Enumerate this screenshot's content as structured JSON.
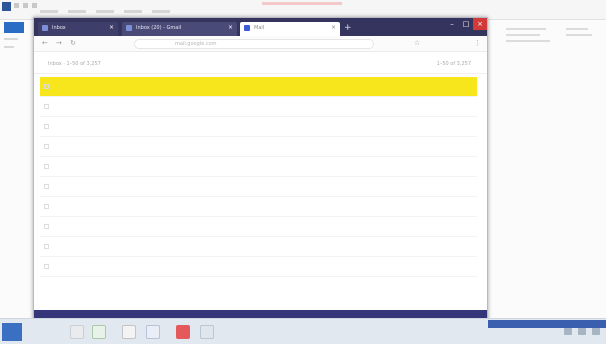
{
  "browser": {
    "tabs": [
      {
        "label": "Inbox",
        "close": "×"
      },
      {
        "label": "Inbox (20) - Gmail",
        "close": "×"
      },
      {
        "label": "Mail",
        "close": "×"
      }
    ],
    "new_tab": "+",
    "window_controls": {
      "minimize": "–",
      "maximize": "□",
      "close": "×"
    },
    "toolbar": {
      "back": "←",
      "forward": "→",
      "reload": "↻",
      "menu": "⋮",
      "star": "☆"
    },
    "omnibox_text": "mail.google.com"
  },
  "mail": {
    "path_text": "Inbox · 1–50 of 3,257",
    "pager_text": "1–50 of 3,257",
    "rows": [
      {
        "subject": "",
        "meta": "",
        "highlighted": true
      },
      {
        "subject": "",
        "meta": "",
        "highlighted": false
      },
      {
        "subject": "",
        "meta": "",
        "highlighted": false
      },
      {
        "subject": "",
        "meta": "",
        "highlighted": false
      },
      {
        "subject": "",
        "meta": "",
        "highlighted": false
      },
      {
        "subject": "",
        "meta": "",
        "highlighted": false
      },
      {
        "subject": "",
        "meta": "",
        "highlighted": false
      },
      {
        "subject": "",
        "meta": "",
        "highlighted": false
      },
      {
        "subject": "",
        "meta": "",
        "highlighted": false
      },
      {
        "subject": "",
        "meta": "",
        "highlighted": false
      }
    ],
    "footer_left": "",
    "footer_right": ""
  },
  "colors": {
    "highlight": "#f7e61c",
    "titlebar": "#34345f",
    "bottom_band": "#35357a",
    "close_button": "#d23a3a",
    "start_button": "#3b6fc2"
  },
  "taskbar": {
    "icons": [
      "start-icon",
      "folder-icon",
      "chrome-icon",
      "file-icon",
      "app-icon",
      "stop-icon",
      "tool-icon"
    ]
  }
}
